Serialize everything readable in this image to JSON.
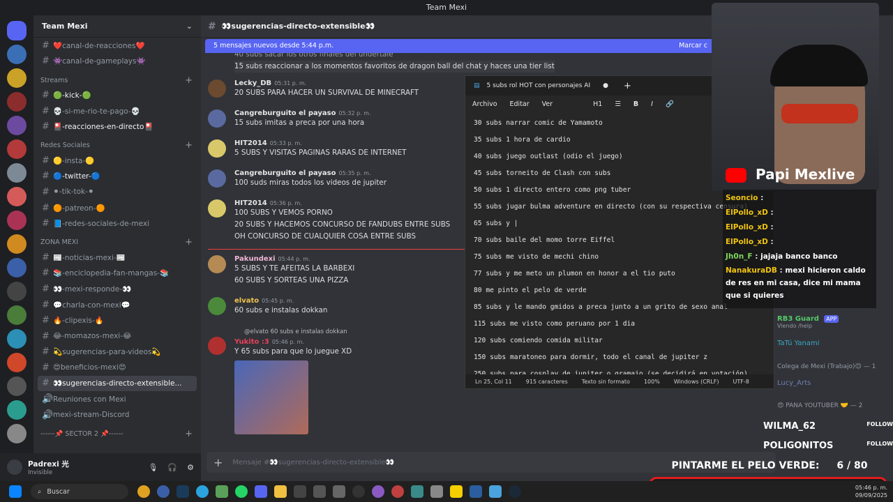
{
  "window": {
    "title": "Team Mexi"
  },
  "guild": {
    "name": "Team Mexi"
  },
  "sidebar": {
    "top_channels": [
      "❤️canal-de-reacciones❤️",
      "👾canal-de-gameplays👾"
    ],
    "categories": [
      {
        "name": "Streams",
        "channels": [
          "🟢-kick-🟢",
          "💀-si-me-rio-te-pago-💀",
          "🎴-reacciones-en-directo🎴"
        ]
      },
      {
        "name": "Redes Sociales",
        "channels": [
          "🟡-insta-🟡",
          "🔵-twitter-🔵",
          "⚫-tik-tok-⚫",
          "🟠-patreon-🟠",
          "📘-redes-sociales-de-mexi"
        ]
      },
      {
        "name": "ZONA MEXI",
        "channels": [
          "📰-noticias-mexi-📰",
          "📚-enciclopedia-fan-mangas-📚",
          "👀-mexi-responde-👀",
          "💬charla-con-mexi💬",
          "🔥-clipexis-🔥",
          "😂-momazos-mexi-😂",
          "💫sugerencias-para-videos💫",
          "😍beneficios-mexi😍",
          "👀sugerencias-directo-extensible...",
          "Reuniones con Mexi",
          "mexi-stream-Discord"
        ]
      },
      {
        "name": "------📌 SECTOR 2 📌------",
        "channels": []
      }
    ]
  },
  "user": {
    "name": "Padrexi 光",
    "status": "Invisible"
  },
  "channel": {
    "name": "👀sugerencias-directo-extensible👀"
  },
  "banner": {
    "text": "5 mensajes nuevos desde 5:44 p.m.",
    "action": "Marcar c"
  },
  "messages": [
    {
      "lines": [
        "40 subs sacar los otros finales del undertale",
        "15 subs reaccionar a los momentos favoritos de dragon ball del chat y haces una tier list"
      ]
    },
    {
      "author": "Lecky_DB",
      "time": "05:31 p. m.",
      "lines": [
        "20 SUBS PARA HACER UN SURVIVAL DE MINECRAFT"
      ]
    },
    {
      "author": "Cangreburguito el payaso",
      "time": "05:32 p. m.",
      "lines": [
        "15 subs imitas a preca por una hora"
      ]
    },
    {
      "author": "HIT2014",
      "time": "05:33 p. m.",
      "lines": [
        "5 SUBS Y VISITAS PAGINAS RARAS DE INTERNET"
      ]
    },
    {
      "author": "Cangreburguito el payaso",
      "time": "05:35 p. m.",
      "lines": [
        "100 suds miras todos los videos de jupiter"
      ]
    },
    {
      "author": "HIT2014",
      "time": "05:36 p. m.",
      "lines": [
        "100 SUBS Y VEMOS PORNO",
        "20 SUBS Y HACEMOS CONCURSO DE FANDUBS ENTRE SUBS",
        "OH CONCURSO DE CUALQUIER COSA ENTRE SUBS"
      ]
    },
    {
      "author": "Pakundexi",
      "time": "05:44 p. m.",
      "lines": [
        "5 SUBS Y TE AFEITAS LA BARBEXI",
        "60 SUBS Y SORTEAS UNA PIZZA"
      ]
    },
    {
      "author": "elvato",
      "time": "05:45 p. m.",
      "lines": [
        "60 subs e instalas dokkan"
      ]
    },
    {
      "author": "Yukito :3",
      "time": "05:46 p. m.",
      "reply": "@elvato  60 subs e instalas dokkan",
      "lines": [
        "Y 65 subs para que lo juegue XD"
      ]
    }
  ],
  "composer": {
    "placeholder": "Mensaje #👀sugerencias-directo-extensible👀"
  },
  "notepad": {
    "tab": "5 subs rol HOT con personajes AI",
    "menu": [
      "Archivo",
      "Editar",
      "Ver"
    ],
    "lines": [
      "30 subs narrar comic de Yamamoto",
      "35 subs 1 hora de cardio",
      "40 subs juego outlast (odio el juego)",
      "45 subs torneito de Clash con subs",
      "50 subs 1 directo entero como png tuber",
      "55 subs jugar bulma adventure en directo (con su respectiva censura)",
      "65 subs y |",
      "70 subs baile del momo torre Eiffel",
      "75 subs me visto de mechi chino",
      "77 subs y me meto un plumon en honor a el tio puto",
      "80 me pinto el pelo de verde",
      "85 subs y le mando gmidos a preca junto a un grito de sexo anal",
      "115 subs me visto como peruano por 1 dia",
      "120 subs comiendo comida militar",
      "150 subs maratoneo para dormir, todo el canal de jupiter z",
      "250 subs para cosplay de jupiter o gramajo (se decidirá en votación)"
    ],
    "status": [
      "Ln 25, Col 11",
      "915 caracteres",
      "Texto sin formato",
      "100%",
      "Windows (CRLF)",
      "UTF-8"
    ]
  },
  "stream": {
    "brand": "Papi Mexlive",
    "chat": [
      {
        "user": "Seoncio",
        "text": ""
      },
      {
        "user": "ElPollo_xD",
        "text": ""
      },
      {
        "user": "ElPollo_xD",
        "text": ""
      },
      {
        "user": "ElPollo_xD",
        "text": ""
      },
      {
        "user": "Jh0n_F",
        "text": "jajaja banco banco"
      },
      {
        "user": "NanakuraDB",
        "text": "mexi hicieron caldo de res en mi casa, dice mi mama que si quieres"
      }
    ],
    "followers": [
      {
        "name": "WILMA_62",
        "tag": "FOLLOW"
      },
      {
        "name": "POLIGONITOS",
        "tag": "FOLLOW"
      }
    ],
    "goal": {
      "label": "PINTARME EL PELO VERDE:",
      "current": 6,
      "target": 80,
      "display": "6 / 80"
    }
  },
  "members": [
    {
      "name": "RB3 Guard",
      "sub": "Viendo /help",
      "badge": "APP"
    },
    {
      "name": "TaTú Yanami",
      "sub": ""
    },
    {
      "group": "Colega de Mexi (Trabajo)😊 — 1"
    },
    {
      "name": "Lucy_Arts",
      "sub": ""
    },
    {
      "group": "😍 PANA YOUTUBER 🤝 — 2"
    }
  ],
  "taskbar": {
    "search": "Buscar",
    "time": "05:46 p. m.",
    "date": "09/09/2025"
  },
  "colors": {
    "accent": "#5865f2",
    "bg": "#313338",
    "sidebar": "#2b2d31",
    "goal_border": "#e01d1d"
  }
}
